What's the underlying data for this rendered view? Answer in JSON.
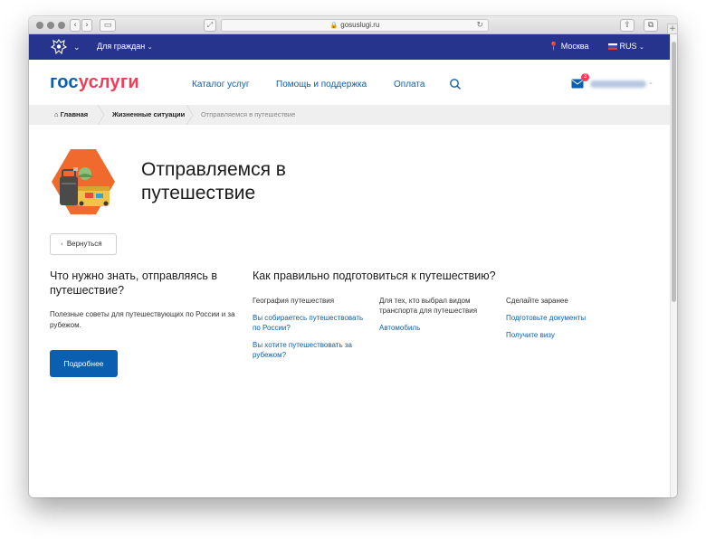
{
  "browser": {
    "url": "gosuslugi.ru",
    "icons": [
      "back-icon",
      "forward-icon",
      "sidebar-icon",
      "zoom-icon",
      "lock-icon",
      "reload-icon",
      "share-icon",
      "tabs-icon",
      "plus-icon"
    ]
  },
  "govbar": {
    "audience": "Для граждан",
    "location": "Москва",
    "language": "RUS",
    "color": "#26348e"
  },
  "header": {
    "logo_part1": "гос",
    "logo_part2": "услуги",
    "nav": [
      "Каталог услуг",
      "Помощь и поддержка",
      "Оплата"
    ],
    "mail_count": "3"
  },
  "breadcrumb": {
    "items": [
      "Главная",
      "Жизненные ситуации",
      "Отправляемся в путешествие"
    ]
  },
  "page": {
    "title": "Отправляемся в путешествие",
    "back_label": "Вернуться"
  },
  "left": {
    "heading": "Что нужно знать, отправляясь в путешествие?",
    "text": "Полезные советы для путешествующих по России и за рубежом.",
    "button": "Подробнее"
  },
  "right": {
    "heading": "Как правильно подготовиться к путешествию?",
    "columns": [
      {
        "label": "География путешествия",
        "links": [
          "Вы собираетесь путешествовать по России?",
          "Вы хотите путешествовать за рубежом?"
        ]
      },
      {
        "label": "Для тех, кто выбрал видом транспорта для путешествия",
        "links": [
          "Автомобиль"
        ]
      },
      {
        "label": "Сделайте заранее",
        "links": [
          "Подготовьте документы",
          "Получите визу"
        ]
      }
    ]
  },
  "colors": {
    "brand_blue": "#0b5fb0",
    "brand_red": "#ee3f58",
    "hero_orange": "#ef6a2c"
  }
}
